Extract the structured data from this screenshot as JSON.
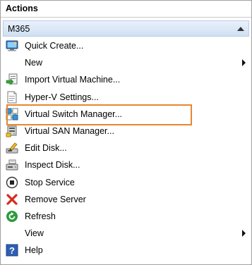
{
  "pane": {
    "title": "Actions",
    "section": "M365"
  },
  "items": [
    {
      "label": "Quick Create...",
      "icon": "quick-create-icon",
      "submenu": false
    },
    {
      "label": "New",
      "icon": "none",
      "submenu": true
    },
    {
      "label": "Import Virtual Machine...",
      "icon": "import-vm-icon",
      "submenu": false
    },
    {
      "label": "Hyper-V Settings...",
      "icon": "settings-document-icon",
      "submenu": false
    },
    {
      "label": "Virtual Switch Manager...",
      "icon": "virtual-switch-icon",
      "submenu": false
    },
    {
      "label": "Virtual SAN Manager...",
      "icon": "virtual-san-icon",
      "submenu": false
    },
    {
      "label": "Edit Disk...",
      "icon": "edit-disk-icon",
      "submenu": false
    },
    {
      "label": "Inspect Disk...",
      "icon": "inspect-disk-icon",
      "submenu": false
    },
    {
      "label": "Stop Service",
      "icon": "stop-icon",
      "submenu": false
    },
    {
      "label": "Remove Server",
      "icon": "remove-x-icon",
      "submenu": false
    },
    {
      "label": "Refresh",
      "icon": "refresh-icon",
      "submenu": false
    },
    {
      "label": "View",
      "icon": "none",
      "submenu": true
    },
    {
      "label": "Help",
      "icon": "help-icon",
      "submenu": false
    }
  ],
  "highlight": {
    "target": "Virtual Switch Manager...",
    "color": "#e8872e"
  }
}
